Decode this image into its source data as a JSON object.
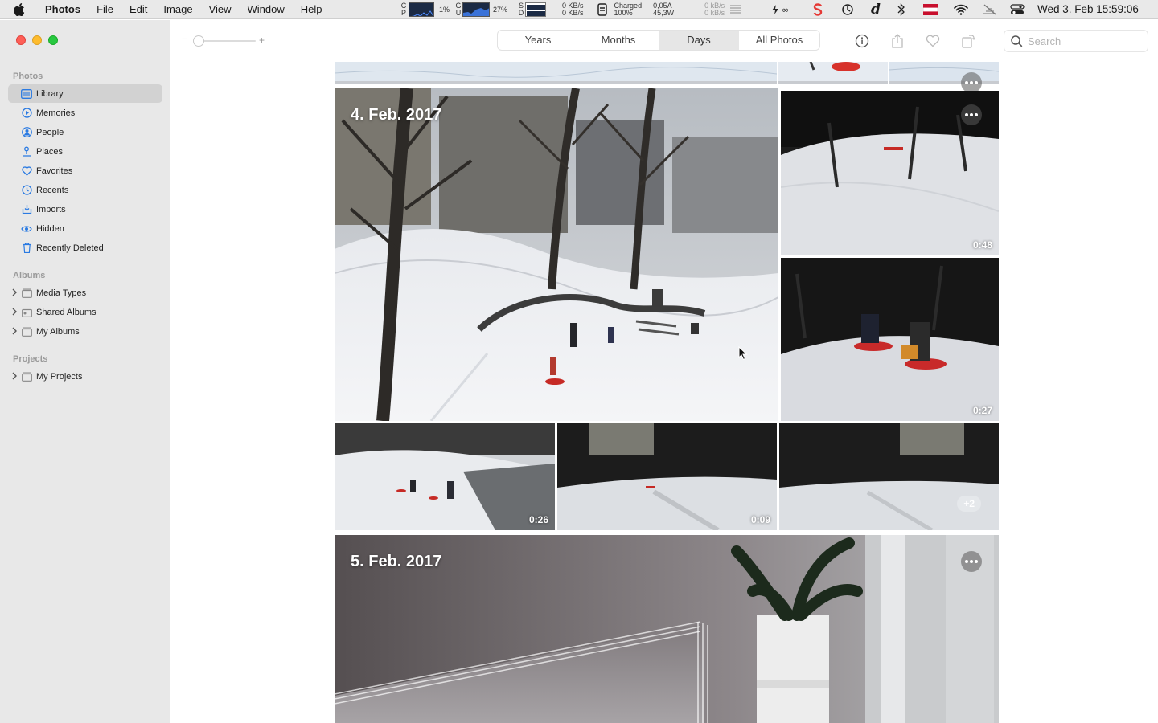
{
  "menubar": {
    "app_name": "Photos",
    "menus": [
      "File",
      "Edit",
      "Image",
      "View",
      "Window",
      "Help"
    ],
    "cpu_percent": "1%",
    "mem_percent": "27%",
    "net_up": "0 KB/s",
    "net_down": "0 KB/s",
    "battery_status": "Charged",
    "battery_percent": "100%",
    "current": "0,05A",
    "power": "45,3W",
    "disk_up": "0 kB/s",
    "disk_down": "0 kB/s",
    "clock": "Wed 3. Feb  15:59:06"
  },
  "sidebar": {
    "photos_header": "Photos",
    "items": [
      {
        "label": "Library",
        "icon": "library-icon",
        "selected": true
      },
      {
        "label": "Memories",
        "icon": "memories-icon"
      },
      {
        "label": "People",
        "icon": "people-icon"
      },
      {
        "label": "Places",
        "icon": "places-icon"
      },
      {
        "label": "Favorites",
        "icon": "heart-icon"
      },
      {
        "label": "Recents",
        "icon": "clock-icon"
      },
      {
        "label": "Imports",
        "icon": "import-icon"
      },
      {
        "label": "Hidden",
        "icon": "eye-icon"
      },
      {
        "label": "Recently Deleted",
        "icon": "trash-icon"
      }
    ],
    "albums_header": "Albums",
    "albums": [
      {
        "label": "Media Types"
      },
      {
        "label": "Shared Albums"
      },
      {
        "label": "My Albums"
      }
    ],
    "projects_header": "Projects",
    "projects": [
      {
        "label": "My Projects"
      }
    ]
  },
  "toolbar": {
    "zoom_minus": "−",
    "zoom_plus": "+",
    "segments": [
      "Years",
      "Months",
      "Days",
      "All Photos"
    ],
    "active_segment": "Days",
    "search_placeholder": "Search"
  },
  "days": [
    {
      "title": "4. Feb. 2017",
      "durations": [
        "0:48",
        "0:27",
        "0:26",
        "0:09"
      ],
      "more_count": "+2"
    },
    {
      "title": "5. Feb. 2017"
    }
  ],
  "colors": {
    "sidebar_bg": "#e8e8e8",
    "selected_bg": "#d2d2d2",
    "accent_blue": "#2a7ae2"
  }
}
